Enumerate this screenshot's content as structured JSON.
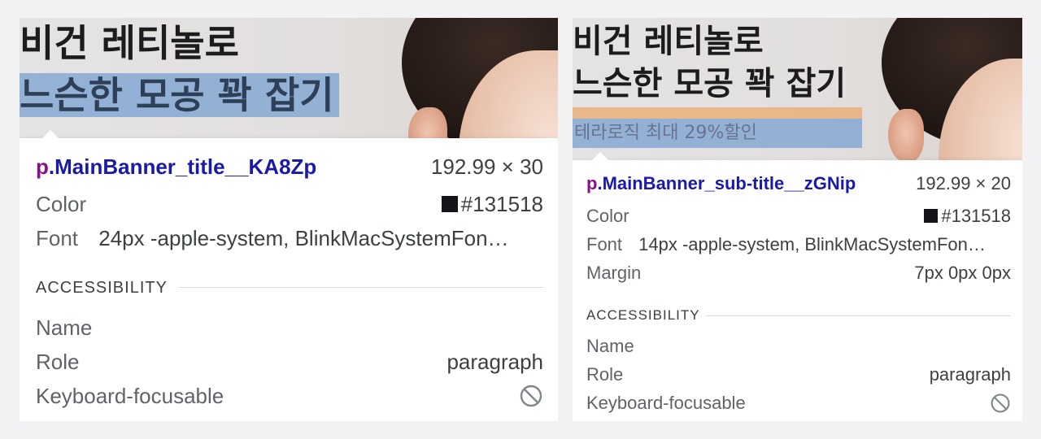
{
  "panels": [
    {
      "banner": {
        "title_line1": "비건 레티놀로",
        "title_line2": "느슨한 모공 꽉 잡기"
      },
      "tooltip": {
        "selector_tag": "p",
        "selector_class": ".MainBanner_title__KA8Zp",
        "dimensions": "192.99 × 30",
        "color_label": "Color",
        "color_value": "#131518",
        "font_label": "Font",
        "font_value": "24px -apple-system, BlinkMacSystemFon…",
        "accessibility_heading": "ACCESSIBILITY",
        "name_label": "Name",
        "role_label": "Role",
        "role_value": "paragraph",
        "focusable_label": "Keyboard-focusable",
        "focusable_icon": "not-allowed-icon"
      }
    },
    {
      "banner": {
        "title_line1": "비건 레티놀로",
        "title_line2": "느슨한 모공 꽉 잡기",
        "subtitle": "테라로직 최대 29%할인"
      },
      "tooltip": {
        "selector_tag": "p",
        "selector_class": ".MainBanner_sub-title__zGNip",
        "dimensions": "192.99 × 20",
        "color_label": "Color",
        "color_value": "#131518",
        "font_label": "Font",
        "font_value": "14px -apple-system, BlinkMacSystemFon…",
        "margin_label": "Margin",
        "margin_value": "7px 0px 0px",
        "accessibility_heading": "ACCESSIBILITY",
        "name_label": "Name",
        "role_label": "Role",
        "role_value": "paragraph",
        "focusable_label": "Keyboard-focusable",
        "focusable_icon": "not-allowed-icon"
      }
    }
  ],
  "colors": {
    "highlight_content": "#8fb4dc",
    "highlight_margin": "#e8b07a",
    "swatch": "#131518"
  }
}
